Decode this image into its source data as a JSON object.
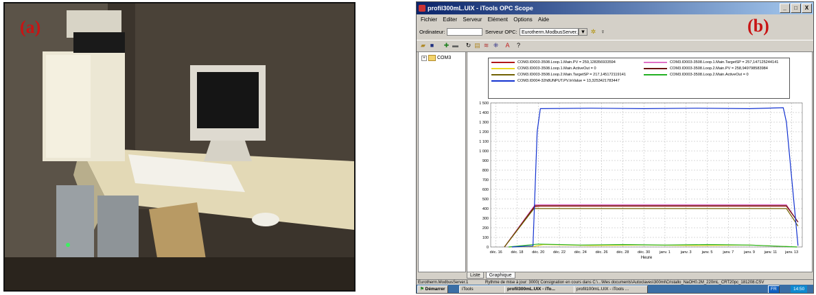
{
  "panel_a": {
    "label": "(a)"
  },
  "panel_b": {
    "label": "(b)",
    "window": {
      "title": "profil300mL.UIX - iTools OPC Scope",
      "minimize": "_",
      "maximize": "□",
      "close": "X"
    },
    "menu": [
      "Fichier",
      "Editer",
      "Serveur",
      "Elément",
      "Options",
      "Aide"
    ],
    "toolbar": {
      "ordinateur_label": "Ordinateur:",
      "ordinateur_value": "",
      "serveur_label": "Serveur OPC:",
      "serveur_value": "Eurotherm.ModbusServer.1"
    },
    "tree": {
      "root": "COM3"
    },
    "tabs": [
      "Liste",
      "Graphique"
    ],
    "status": {
      "server": "Eurotherm.ModbusServer.1",
      "message": "Rythme de mise à jour:  3000( Consignation en cours dans C:\\...\\Mes documents\\Autoclaves\\300ml\\Cristallo_NaOH0.2M_220mL_CRT20pc_181208.CSV"
    },
    "taskbar": {
      "start": "Démarrer",
      "items": [
        "iTools",
        "profil300mL.UIX - iTo...",
        "profil100mL.UIX - iTools ..."
      ],
      "lang": "FR",
      "clock": "14:50"
    },
    "colors": {
      "loop1_pv": "#b01818",
      "loop1_target": "#e070c8",
      "loop1_active": "#e8d820",
      "loop2_pv": "#6a1010",
      "loop2_target": "#706000",
      "loop2_active": "#20b020",
      "inval": "#1030d0"
    }
  },
  "chart_data": {
    "type": "line",
    "title": "",
    "xlabel": "Heure",
    "ylabel": "",
    "ylim": [
      0,
      1500
    ],
    "yticks": [
      0,
      100,
      200,
      300,
      400,
      500,
      600,
      700,
      800,
      900,
      1000,
      1100,
      1200,
      1300,
      1400,
      1500
    ],
    "ytick_labels": [
      "0",
      "100",
      "200",
      "300",
      "400",
      "500",
      "600",
      "700",
      "800",
      "900",
      "1 000",
      "1 100",
      "1 200",
      "1 300",
      "1 400",
      "1 500"
    ],
    "xticks": [
      16,
      18,
      20,
      22,
      24,
      26,
      28,
      30,
      32,
      34,
      36,
      38,
      40,
      42,
      44
    ],
    "xtick_labels": [
      "déc. 16",
      "déc. 18",
      "déc. 20",
      "déc. 22",
      "déc. 24",
      "déc. 26",
      "déc. 28",
      "déc. 30",
      "janv. 1",
      "janv. 3",
      "janv. 5",
      "janv. 7",
      "janv. 9",
      "janv. 11",
      "janv. 13"
    ],
    "xlim": [
      15.5,
      45
    ],
    "grid": true,
    "legend_position": "top",
    "series": [
      {
        "name": "COM3.ID003-3508.Loop.1.Main.PV = 259,128356933594",
        "color_key": "loop1_pv",
        "x": [
          16.8,
          19.7,
          20.2,
          43.5,
          44.6
        ],
        "y": [
          0,
          420,
          425,
          425,
          260
        ]
      },
      {
        "name": "COM3.ID003-3508.Loop.1.Main.TargetSP = 257,147125244141",
        "color_key": "loop1_target",
        "x": [
          16.8,
          19.7,
          20.2,
          43.5,
          44.6
        ],
        "y": [
          0,
          440,
          440,
          440,
          257
        ]
      },
      {
        "name": "COM3.ID003-3508.Loop.1.Main.ActiveOut = 0",
        "color_key": "loop1_active",
        "x": [
          17.2,
          19.5,
          20.5,
          25,
          30,
          35,
          40,
          44.5
        ],
        "y": [
          0,
          5,
          25,
          15,
          20,
          15,
          20,
          0
        ]
      },
      {
        "name": "COM3.ID003-3508.Loop.2.Main.PV = 258,949798583984",
        "color_key": "loop2_pv",
        "x": [
          16.8,
          19.7,
          20.2,
          43.5,
          44.6
        ],
        "y": [
          0,
          430,
          430,
          430,
          259
        ]
      },
      {
        "name": "COM3.ID003-3508.Loop.2.Main.TargetSP = 217,145172119141",
        "color_key": "loop2_target",
        "x": [
          16.8,
          19.6,
          20.2,
          43.5,
          44.6
        ],
        "y": [
          0,
          400,
          400,
          400,
          217
        ]
      },
      {
        "name": "COM3.ID003-3508.Loop.2.Main.ActiveOut = 0",
        "color_key": "loop2_active",
        "x": [
          17.2,
          20.0,
          24.0,
          28.0,
          32.0,
          36.0,
          40.0,
          44.5
        ],
        "y": [
          0,
          30,
          20,
          25,
          20,
          25,
          20,
          0
        ]
      },
      {
        "name": "COM3.ID004-32h8UNPUT.PV.InValue = 13,3253421783447",
        "color_key": "inval",
        "x": [
          17.5,
          19.5,
          19.9,
          20.2,
          25,
          30,
          35,
          40,
          43.2,
          43.5,
          44.6
        ],
        "y": [
          0,
          10,
          1200,
          1440,
          1445,
          1440,
          1445,
          1440,
          1450,
          1300,
          13
        ]
      }
    ]
  }
}
